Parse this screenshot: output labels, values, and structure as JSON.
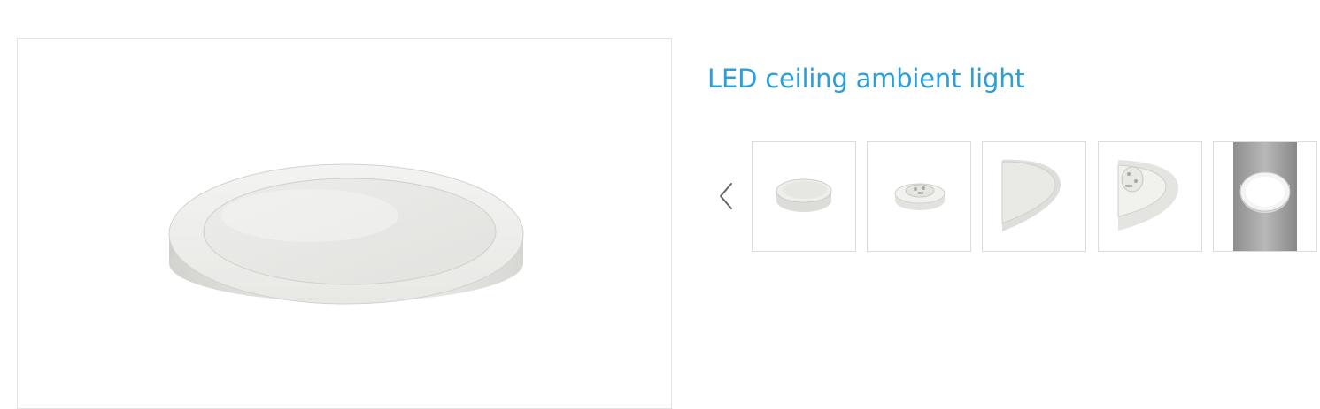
{
  "product": {
    "title": "LED ceiling ambient light"
  },
  "gallery": {
    "main_image": "round-led-ceiling-panel-light",
    "prev_icon": "chevron-left-icon",
    "thumbnails": [
      "panel-light-front-view",
      "panel-light-back-view",
      "panel-light-edge-closeup",
      "panel-light-back-closeup",
      "panel-light-installed-on-ceiling"
    ]
  },
  "colors": {
    "title": "#2a9fd9",
    "border": "#dcdcdc",
    "arrow": "#666666"
  }
}
